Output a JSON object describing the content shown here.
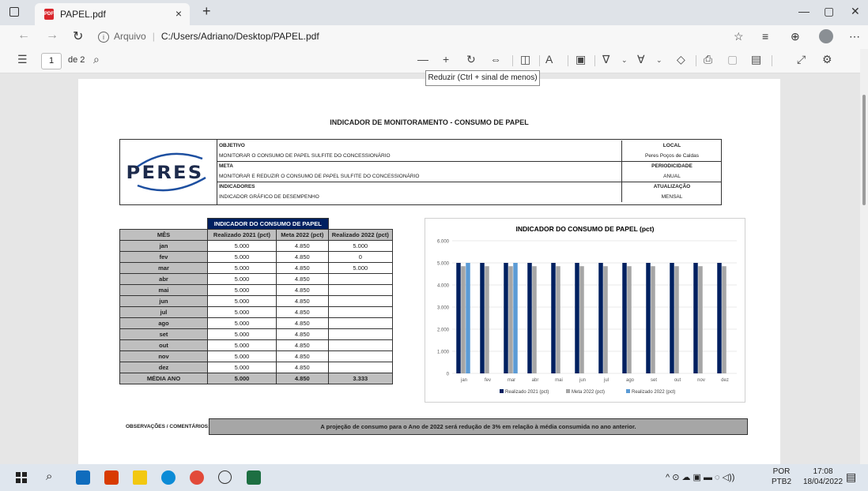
{
  "browser": {
    "tab_title": "PAPEL.pdf",
    "tab_close": "×",
    "new_tab": "+",
    "url_source": "Arquivo",
    "url_path": "C:/Users/Adriano/Desktop/PAPEL.pdf",
    "window_controls": [
      "—",
      "▢",
      "✕"
    ]
  },
  "pdf_toolbar": {
    "page_current": "1",
    "page_total": "de 2",
    "tooltip": "Reduzir (Ctrl + sinal de menos)"
  },
  "document": {
    "title": "INDICADOR DE MONITORAMENTO - CONSUMO DE PAPEL",
    "logo_text": "PERES",
    "header_rows": [
      {
        "left": "OBJETIVO",
        "right": "LOCAL",
        "bold": true
      },
      {
        "left": "MONITORAR O CONSUMO DE PAPEL SULFITE DO CONCESSIONÁRIO",
        "right": "Peres Poços de Caldas",
        "bold": false
      },
      {
        "left": "META",
        "right": "PERIODICIDADE",
        "bold": true
      },
      {
        "left": "MONITORAR E REDUZIR O CONSUMO DE PAPEL SULFITE DO CONCESSIONÁRIO",
        "right": "ANUAL",
        "bold": false
      },
      {
        "left": "INDICADORES",
        "right": "ATUALIZAÇÃO",
        "bold": true
      },
      {
        "left": "INDICADOR GRÁFICO DE DESEMPENHO",
        "right": "MENSAL",
        "bold": false
      }
    ],
    "table": {
      "title": "INDICADOR DO CONSUMO DE PAPEL",
      "columns": [
        "MÊS",
        "Realizado 2021 (pct)",
        "Meta 2022 (pct)",
        "Realizado 2022 (pct)"
      ],
      "rows": [
        [
          "jan",
          "5.000",
          "4.850",
          "5.000"
        ],
        [
          "fev",
          "5.000",
          "4.850",
          "0"
        ],
        [
          "mar",
          "5.000",
          "4.850",
          "5.000"
        ],
        [
          "abr",
          "5.000",
          "4.850",
          ""
        ],
        [
          "mai",
          "5.000",
          "4.850",
          ""
        ],
        [
          "jun",
          "5.000",
          "4.850",
          ""
        ],
        [
          "jul",
          "5.000",
          "4.850",
          ""
        ],
        [
          "ago",
          "5.000",
          "4.850",
          ""
        ],
        [
          "set",
          "5.000",
          "4.850",
          ""
        ],
        [
          "out",
          "5.000",
          "4.850",
          ""
        ],
        [
          "nov",
          "5.000",
          "4.850",
          ""
        ],
        [
          "dez",
          "5.000",
          "4.850",
          ""
        ]
      ],
      "total": [
        "MÉDIA ANO",
        "5.000",
        "4.850",
        "3.333"
      ]
    },
    "obs_label": "OBSERVAÇÕES / COMENTÁRIOS:",
    "obs_text": "A projeção de consumo para o Ano de 2022 será redução de 3% em relação à média consumida no ano anterior."
  },
  "chart_data": {
    "type": "bar",
    "title": "INDICADOR DO CONSUMO DE PAPEL (pct)",
    "categories": [
      "jan",
      "fev",
      "mar",
      "abr",
      "mai",
      "jun",
      "jul",
      "ago",
      "set",
      "out",
      "nov",
      "dez"
    ],
    "series": [
      {
        "name": "Realizado 2021 (pct)",
        "color": "#002060",
        "values": [
          5000,
          5000,
          5000,
          5000,
          5000,
          5000,
          5000,
          5000,
          5000,
          5000,
          5000,
          5000
        ]
      },
      {
        "name": "Meta 2022 (pct)",
        "color": "#a6a6a6",
        "values": [
          4850,
          4850,
          4850,
          4850,
          4850,
          4850,
          4850,
          4850,
          4850,
          4850,
          4850,
          4850
        ]
      },
      {
        "name": "Realizado 2022 (pct)",
        "color": "#5b9bd5",
        "values": [
          5000,
          0,
          5000,
          null,
          null,
          null,
          null,
          null,
          null,
          null,
          null,
          null
        ]
      }
    ],
    "yticks": [
      "0",
      "1.000",
      "2.000",
      "3.000",
      "4.000",
      "5.000",
      "6.000"
    ],
    "ylim": [
      0,
      6000
    ],
    "legend": "bottom",
    "grid": true
  },
  "taskbar": {
    "lang_line1": "POR",
    "lang_line2": "PTB2",
    "time": "17:08",
    "date": "18/04/2022"
  }
}
